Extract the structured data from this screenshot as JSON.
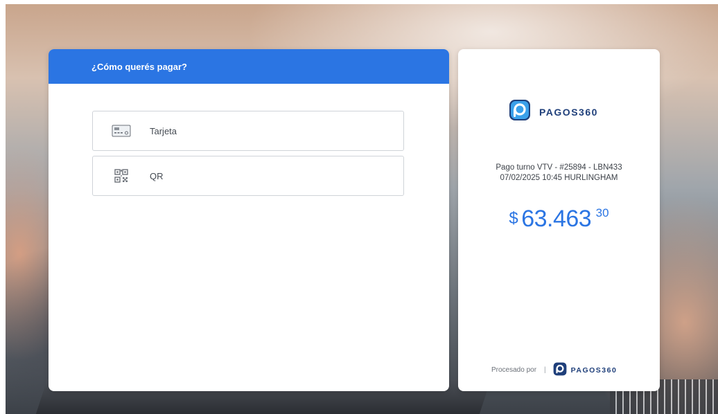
{
  "payment_options": {
    "title": "¿Cómo querés pagar?",
    "options": [
      {
        "label": "Tarjeta",
        "icon": "credit-card-icon"
      },
      {
        "label": "QR",
        "icon": "qr-code-icon"
      }
    ]
  },
  "summary": {
    "brand": "PAGOS360",
    "description_line1": "Pago turno VTV - #25894 - LBN433",
    "description_line2": "07/02/2025 10:45 HURLINGHAM",
    "amount": {
      "currency": "$",
      "integer": "63.463",
      "decimals": "30"
    },
    "footer": {
      "processed_by": "Procesado por",
      "separator": "|",
      "brand": "PAGOS360"
    }
  },
  "colors": {
    "accent": "#2b75e3",
    "brand_dark": "#1f3f7a"
  }
}
